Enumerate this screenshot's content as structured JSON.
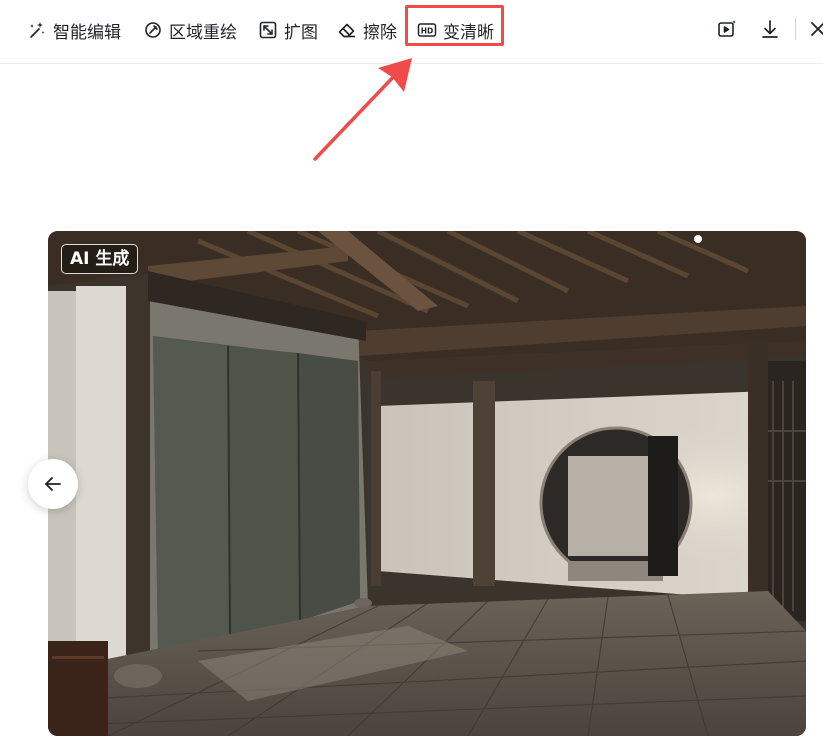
{
  "toolbar": {
    "tools": [
      {
        "label": "智能编辑",
        "icon": "magic-wand-icon"
      },
      {
        "label": "区域重绘",
        "icon": "brush-redraw-icon"
      },
      {
        "label": "扩图",
        "icon": "expand-icon"
      },
      {
        "label": "擦除",
        "icon": "eraser-icon"
      },
      {
        "label": "变清晰",
        "icon": "hd-icon",
        "highlighted": true
      }
    ],
    "right_icons": [
      "video-sparkle-icon",
      "download-icon",
      "close-icon"
    ]
  },
  "annotation": {
    "color": "#ef4b4b",
    "target": "变清晰"
  },
  "image": {
    "badge": "AI 生成",
    "description_icon": "photo"
  },
  "navigation": {
    "prev_icon": "arrow-left-icon"
  }
}
